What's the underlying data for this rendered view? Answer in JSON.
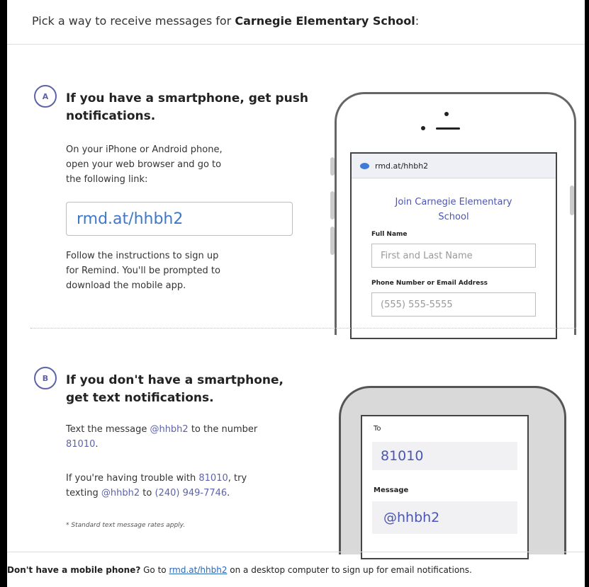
{
  "header": {
    "prefix": "Pick a way to receive messages for ",
    "school": "Carnegie Elementary School",
    "suffix": ":"
  },
  "sectionA": {
    "badge": "A",
    "title_line1": "If you have a smartphone, get push",
    "title_line2": "notifications.",
    "instr_line1": "On your iPhone or Android phone,",
    "instr_line2": "open your web browser and go to",
    "instr_line3": "the following link:",
    "link": "rmd.at/hhbh2",
    "follow_line1": "Follow the instructions to sign up",
    "follow_line2": "for Remind. You'll be prompted to",
    "follow_line3": "download the mobile app.",
    "phone": {
      "url": "rmd.at/hhbh2",
      "join_line1": "Join Carnegie Elementary",
      "join_line2": "School",
      "fullname_label": "Full Name",
      "fullname_placeholder": "First and Last Name",
      "contact_label": "Phone Number or Email Address",
      "contact_placeholder": "(555) 555-5555"
    }
  },
  "sectionB": {
    "badge": "B",
    "title_line1": "If you don't have a smartphone,",
    "title_line2": "get text notifications.",
    "text_pre": "Text the message ",
    "code": "@hhbh2",
    "text_mid": " to the number",
    "number": "81010",
    "period": ".",
    "trouble_pre": "If you're having trouble with ",
    "trouble_mid": ", try",
    "texting": "texting ",
    "to_word": " to ",
    "alt_number": "(240) 949-7746",
    "rates_note": "* Standard text message rates apply.",
    "phone": {
      "to_label": "To",
      "to_value": "81010",
      "message_label": "Message",
      "message_value": "@hhbh2"
    }
  },
  "footer": {
    "question": "Don't have a mobile phone?",
    "go_to": " Go to ",
    "link": "rmd.at/hhbh2",
    "rest": " on a desktop computer to sign up for email notifications."
  }
}
